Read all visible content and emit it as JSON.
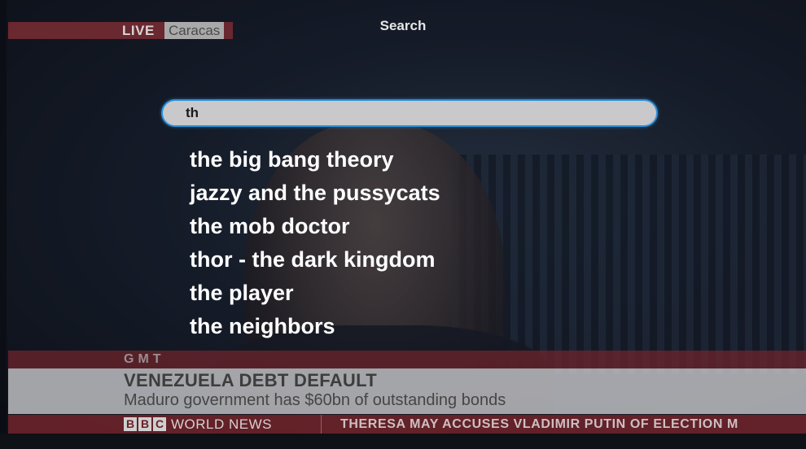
{
  "live_bug": {
    "live_label": "LIVE",
    "location": "Caracas"
  },
  "search": {
    "title": "Search",
    "query": "th"
  },
  "suggestions": [
    "the big bang theory",
    "jazzy and the pussycats",
    "the mob doctor",
    "thor - the dark kingdom",
    "the player",
    "the neighbors"
  ],
  "lower_third": {
    "gmt_label": "GMT",
    "headline": "VENEZUELA DEBT DEFAULT",
    "subheadline": "Maduro government has $60bn of outstanding bonds",
    "channel_letters": [
      "B",
      "B",
      "C"
    ],
    "channel_name": "WORLD NEWS",
    "ticker": "THERESA MAY ACCUSES VLADIMIR PUTIN OF ELECTION M"
  },
  "colors": {
    "accent": "#2f8fd8",
    "bbc_red": "#7a2b33",
    "input_bg": "#c9c9cb",
    "suggestion_text": "#ffffff"
  }
}
